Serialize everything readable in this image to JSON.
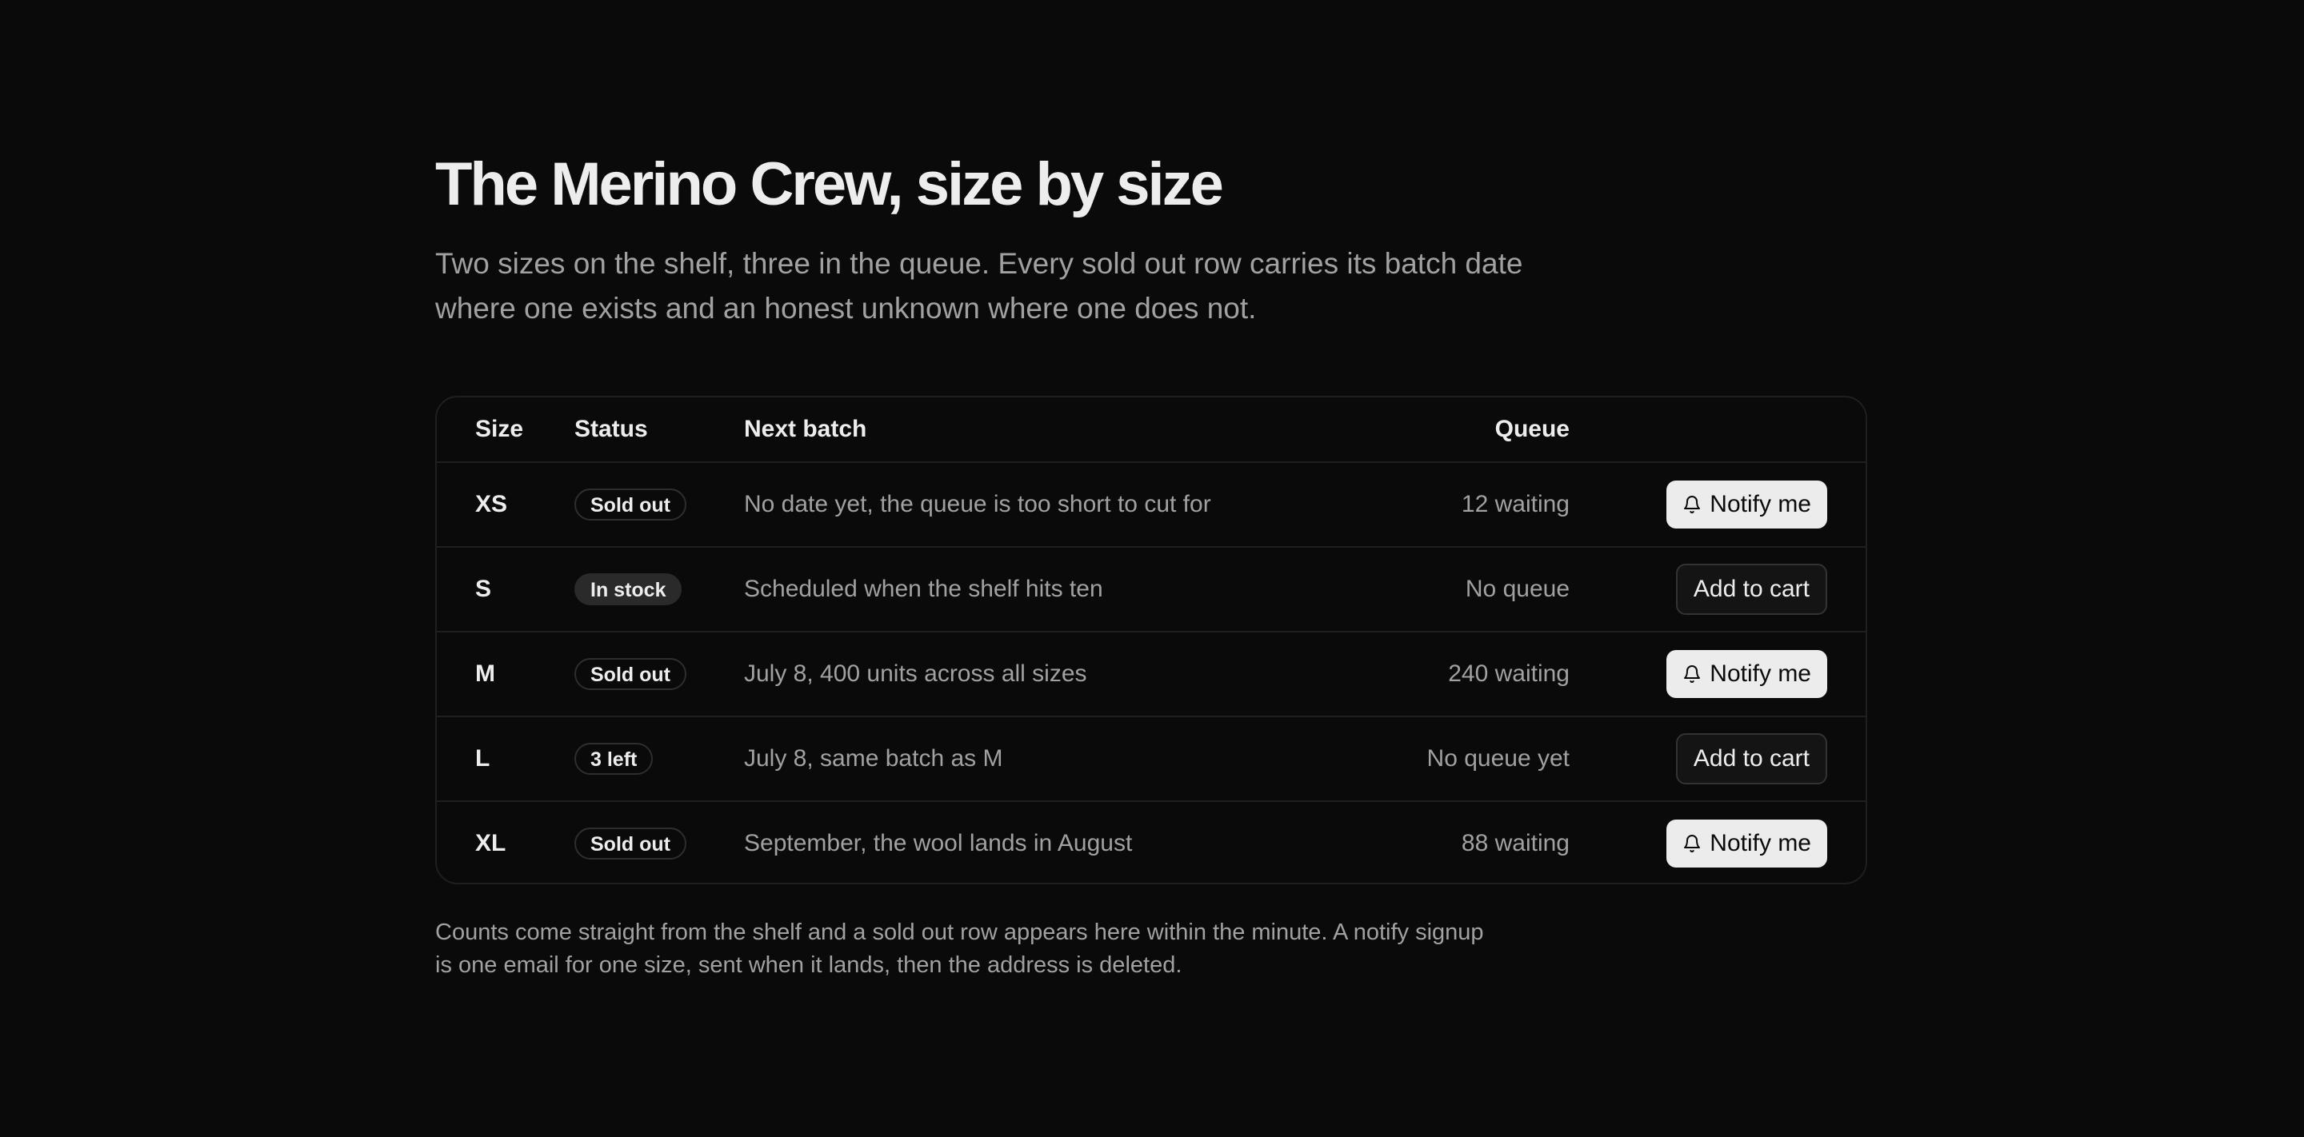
{
  "page": {
    "title": "The Merino Crew, size by size",
    "subtitle": "Two sizes on the shelf, three in the queue. Every sold out row carries its batch date where one exists and an honest unknown where one does not.",
    "footnote": "Counts come straight from the shelf and a sold out row appears here within the minute. A notify signup is one email for one size, sent when it lands, then the address is deleted."
  },
  "table": {
    "headers": {
      "size": "Size",
      "status": "Status",
      "next_batch": "Next batch",
      "queue": "Queue"
    },
    "rows": [
      {
        "size": "XS",
        "status": "Sold out",
        "status_style": "outline",
        "next_batch": "No date yet, the queue is too short to cut for",
        "queue": "12 waiting",
        "action": "Notify me",
        "action_type": "notify"
      },
      {
        "size": "S",
        "status": "In stock",
        "status_style": "filled",
        "next_batch": "Scheduled when the shelf hits ten",
        "queue": "No queue",
        "action": "Add to cart",
        "action_type": "cart"
      },
      {
        "size": "M",
        "status": "Sold out",
        "status_style": "outline",
        "next_batch": "July 8, 400 units across all sizes",
        "queue": "240 waiting",
        "action": "Notify me",
        "action_type": "notify"
      },
      {
        "size": "L",
        "status": "3 left",
        "status_style": "outline",
        "next_batch": "July 8, same batch as M",
        "queue": "No queue yet",
        "action": "Add to cart",
        "action_type": "cart"
      },
      {
        "size": "XL",
        "status": "Sold out",
        "status_style": "outline",
        "next_batch": "September, the wool lands in August",
        "queue": "88 waiting",
        "action": "Notify me",
        "action_type": "notify"
      }
    ]
  },
  "icons": {
    "notify": "bell-icon"
  },
  "colors": {
    "background": "#0a0a0a",
    "text_primary": "#ededed",
    "text_muted": "#a1a1a1",
    "border": "#1f1f1f",
    "notify_button_bg": "#ececec"
  }
}
